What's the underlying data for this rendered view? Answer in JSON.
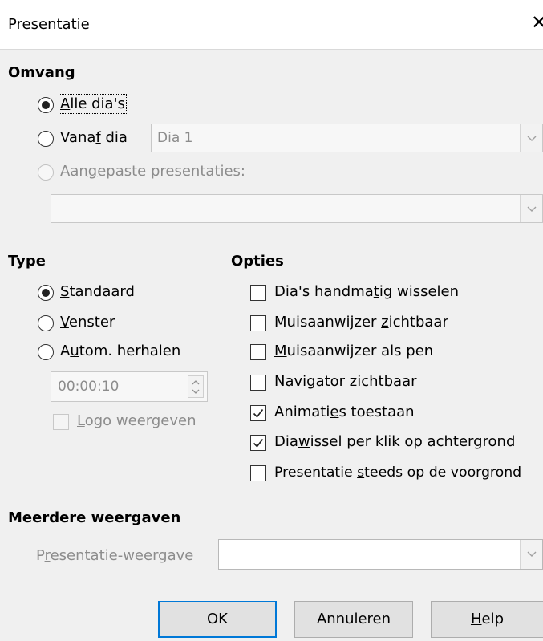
{
  "dialog": {
    "title": "Presentatie"
  },
  "range": {
    "heading": "Omvang",
    "all_slides": {
      "pre": "",
      "key": "A",
      "post": "lle dia's"
    },
    "from_slide": {
      "pre": "Vana",
      "key": "f",
      "post": " dia"
    },
    "from_slide_value": "Dia 1",
    "custom": {
      "pre": "Aan",
      "key": "g",
      "post": "epaste presentaties:"
    },
    "custom_value": ""
  },
  "type": {
    "heading": "Type",
    "standard": {
      "pre": "",
      "key": "S",
      "post": "tandaard"
    },
    "window": {
      "pre": "",
      "key": "V",
      "post": "enster"
    },
    "loop": {
      "pre": "A",
      "key": "u",
      "post": "tom. herhalen"
    },
    "loop_time": "00:00:10",
    "show_logo": {
      "pre": "",
      "key": "L",
      "post": "ogo weergeven"
    }
  },
  "options": {
    "heading": "Opties",
    "manual": {
      "pre": "Dia's handma",
      "key": "t",
      "post": "ig wisselen"
    },
    "pointer_visible": {
      "pre": "Muisaanwijzer ",
      "key": "z",
      "post": "ichtbaar"
    },
    "pointer_pen": {
      "pre": "",
      "key": "M",
      "post": "uisaanwijzer als pen"
    },
    "navigator": {
      "pre": "",
      "key": "N",
      "post": "avigator zichtbaar"
    },
    "animations": {
      "pre": "Animati",
      "key": "e",
      "post": "s toestaan"
    },
    "click_background": {
      "pre": "Dia",
      "key": "w",
      "post": "issel per klik op achtergrond"
    },
    "always_front": {
      "pre": "Presentatie ",
      "key": "s",
      "post": "teeds op de voorgrond"
    }
  },
  "multi": {
    "heading": "Meerdere weergaven",
    "display_label": {
      "pre": "P",
      "key": "r",
      "post": "esentatie-weergave"
    },
    "display_value": ""
  },
  "buttons": {
    "ok": "OK",
    "cancel": "Annuleren",
    "help": {
      "pre": "",
      "key": "H",
      "post": "elp"
    }
  },
  "icons": {
    "close": "close-icon",
    "dropdown": "chevron-down-icon",
    "spin": "spin-arrows-icon",
    "check": "checkmark-icon"
  },
  "colors": {
    "default_button_border": "#0078d7",
    "disabled_text": "#8c8c8c"
  }
}
